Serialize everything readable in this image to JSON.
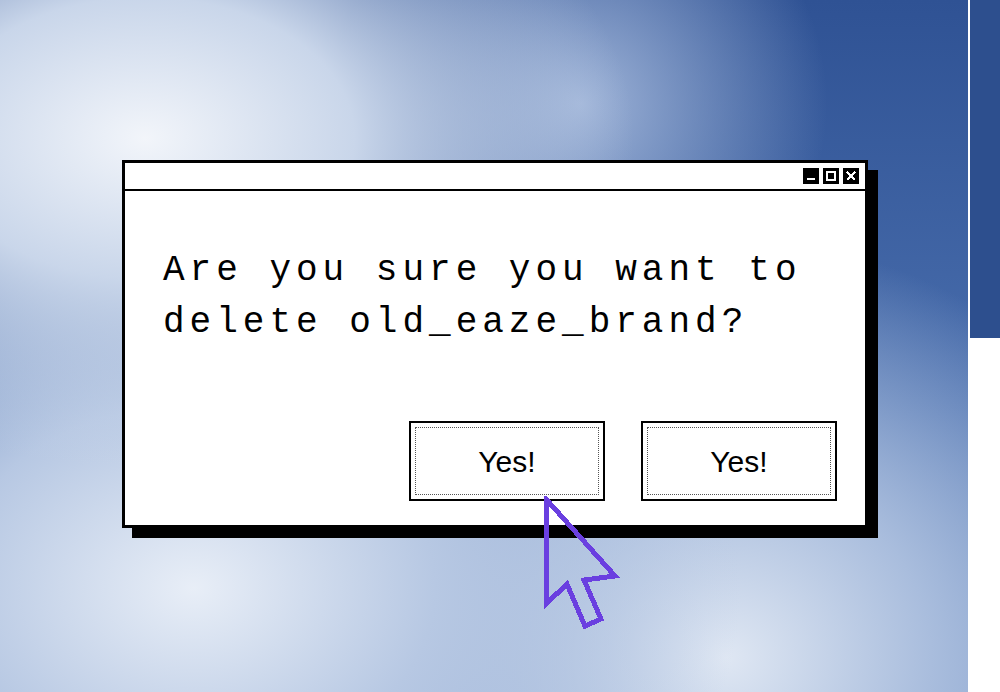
{
  "dialog": {
    "message": "Are you sure you want to delete old_eaze_brand?",
    "buttons": [
      "Yes!",
      "Yes!"
    ]
  }
}
